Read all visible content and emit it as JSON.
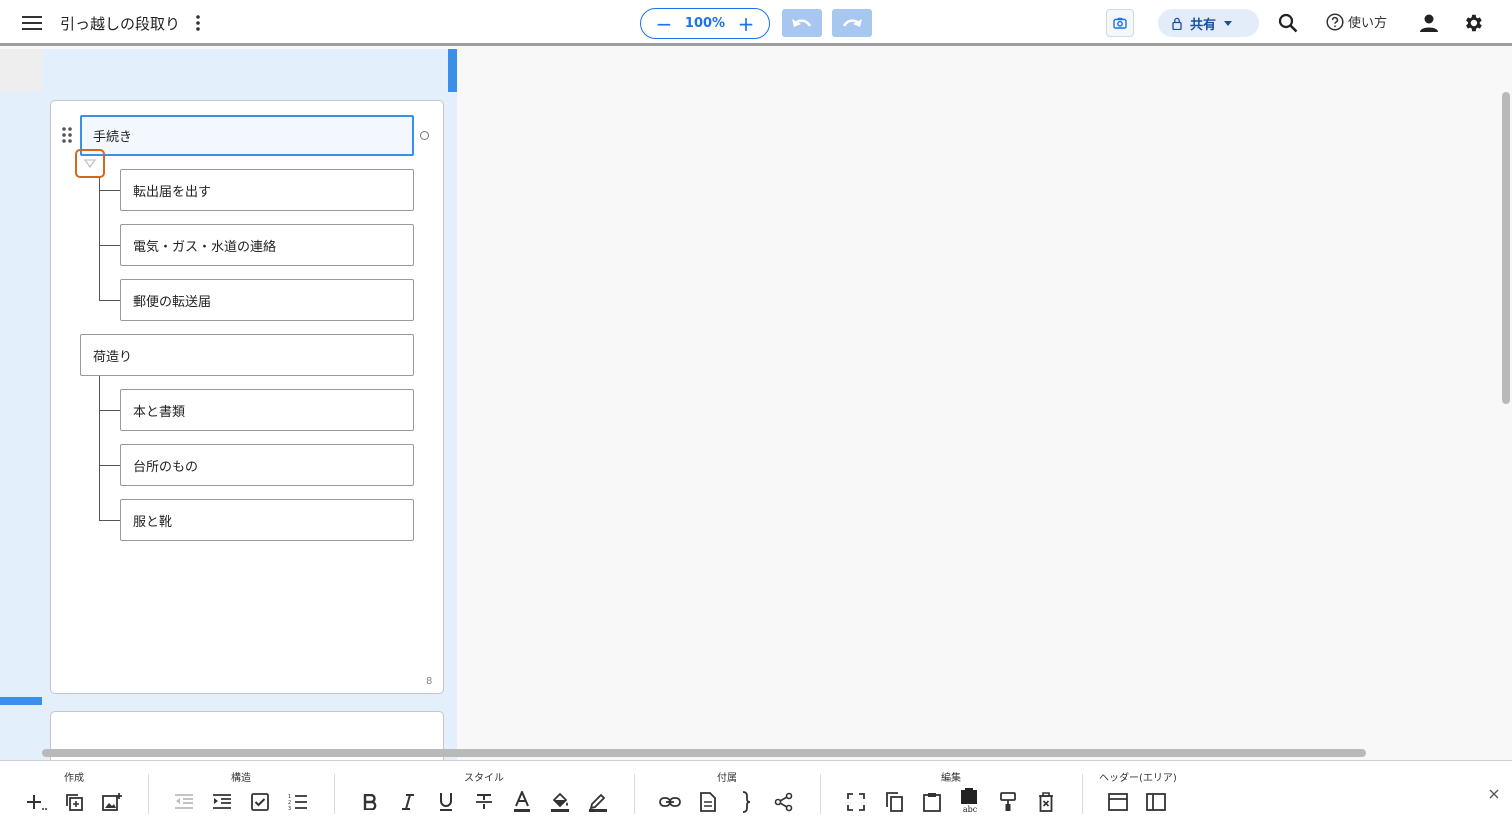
{
  "header": {
    "doc_title": "引っ越しの段取り",
    "zoom": {
      "level": "100%",
      "minus": "−",
      "plus": "+"
    },
    "share_label": "共有",
    "help_label": "使い方"
  },
  "colors": {
    "accent": "#1a73e8",
    "area_background": "#e3f0fc",
    "selected_border": "#3b8fe8",
    "highlight_box": "#d2691e"
  },
  "outline": {
    "groups": [
      {
        "label": "手続き",
        "selected": true,
        "children": [
          "転出届を出す",
          "電気・ガス・水道の連絡",
          "郵便の転送届"
        ]
      },
      {
        "label": "荷造り",
        "selected": false,
        "children": [
          "本と書類",
          "台所のもの",
          "服と靴"
        ]
      }
    ],
    "card_count": "8"
  },
  "toolbar": {
    "groups": {
      "create": "作成",
      "structure": "構造",
      "style": "スタイル",
      "attach": "付属",
      "edit": "編集",
      "header_area": "ヘッダー(エリア)"
    },
    "buttons": {
      "create": [
        "add-node-icon",
        "duplicate-icon",
        "add-image-icon"
      ],
      "structure": [
        "outdent-icon",
        "indent-icon",
        "checkbox-icon",
        "numbered-list-icon"
      ],
      "style": [
        "bold-icon",
        "italic-icon",
        "underline-icon",
        "strikethrough-icon",
        "text-color-icon",
        "fill-color-icon",
        "highlight-icon"
      ],
      "attach": [
        "link-icon",
        "document-icon",
        "brace-icon",
        "share-node-icon"
      ],
      "edit": [
        "select-frame-icon",
        "copy-icon",
        "paste-icon",
        "paste-text-icon",
        "format-painter-icon",
        "delete-icon"
      ],
      "header_area": [
        "header-window-icon",
        "sidebar-layout-icon"
      ]
    }
  }
}
